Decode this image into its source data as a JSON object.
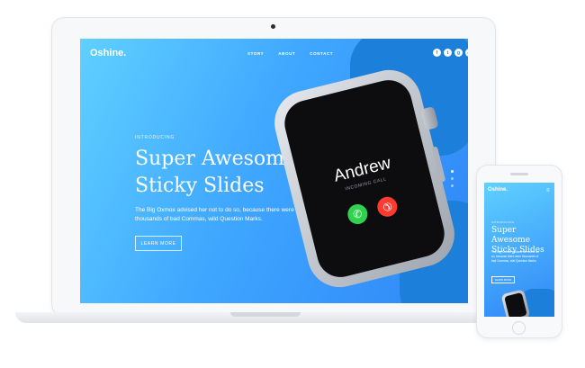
{
  "laptop": {
    "nav": {
      "logo": "Oshine.",
      "links": [
        "STORY",
        "ABOUT",
        "CONTACT"
      ],
      "social_icons": [
        "facebook-icon",
        "twitter-icon",
        "googleplus-icon",
        "instagram-icon"
      ],
      "social_glyphs": [
        "f",
        "t",
        "g",
        "◎"
      ]
    },
    "hero": {
      "eyebrow": "INTRODUCING",
      "headline": "Super Awesome Sticky Slides",
      "description": "The Big Oxmox advised her not to do so, because there were thousands of bad Commas, wild Question Marks.",
      "button": "LEARN MORE"
    },
    "watch": {
      "caller": "Andrew",
      "status": "INCOMING CALL"
    },
    "slide_dots": 3
  },
  "phone": {
    "logo": "Oshine.",
    "menu_glyph": "≡",
    "eyebrow": "INTRODUCING",
    "headline": "Super Awesome Sticky Slides",
    "description": "The Big Oxmox advised her not to do so, because there were thousands of bad Commas, wild Question Marks.",
    "button": "LEARN MORE"
  },
  "colors": {
    "accent": "#2f86f7",
    "accept": "#2fd24e",
    "decline": "#ff3b30"
  }
}
